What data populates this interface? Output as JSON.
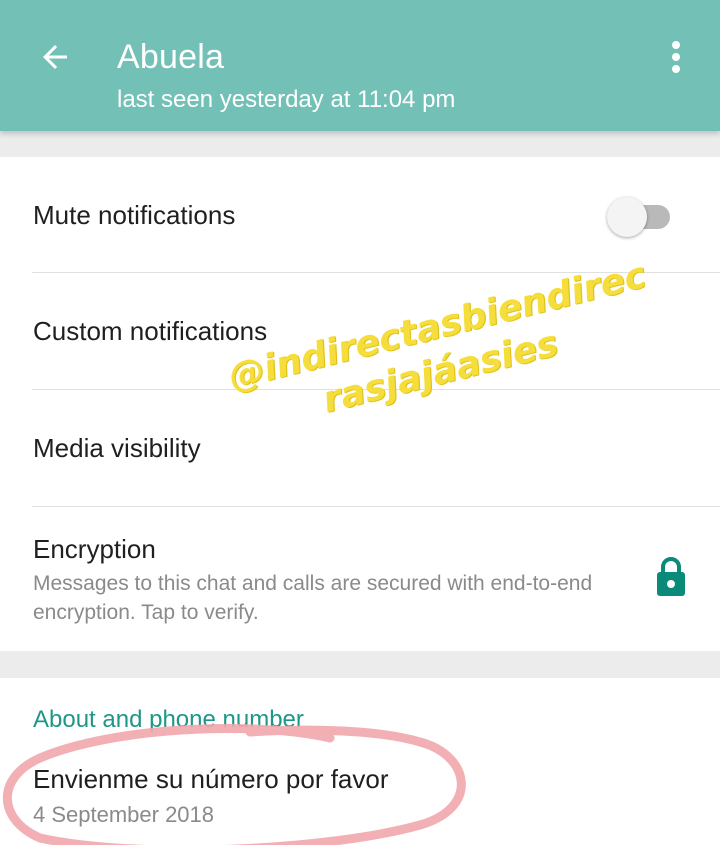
{
  "header": {
    "title": "Abuela",
    "subtitle": "last seen yesterday at 11:04 pm",
    "back_icon": "arrow-back-icon",
    "menu_icon": "more-vert-icon",
    "color": "#73c0b6"
  },
  "settings": {
    "mute": {
      "label": "Mute notifications",
      "enabled": false
    },
    "custom": {
      "label": "Custom notifications"
    },
    "media": {
      "label": "Media visibility"
    },
    "encryption": {
      "label": "Encryption",
      "description": "Messages to this chat and calls are secured with end-to-end encryption. Tap to verify.",
      "icon": "lock-icon",
      "icon_color": "#0a8a78"
    }
  },
  "about": {
    "section_title": "About and phone number",
    "status": "Envienme su número por favor",
    "date": "4 September 2018",
    "accent": "#1e9688"
  },
  "overlay": {
    "watermark_line1": "@indirectasbiendirec",
    "watermark_line2": "rasjajáasies",
    "watermark_color": "#f5de3c",
    "scribble_color": "#f1a7ad"
  }
}
